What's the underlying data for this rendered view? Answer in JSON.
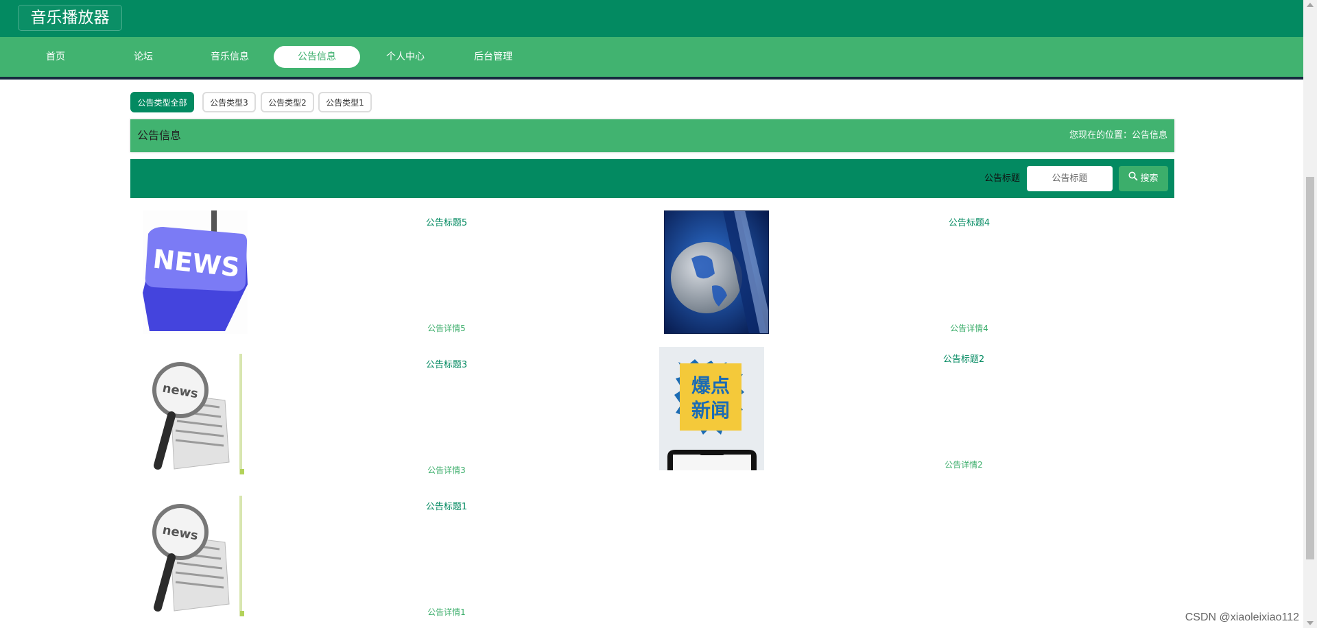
{
  "app": {
    "title": "音乐播放器"
  },
  "nav": {
    "items": [
      "首页",
      "论坛",
      "音乐信息",
      "公告信息",
      "个人中心",
      "后台管理"
    ],
    "active": "公告信息"
  },
  "filters": {
    "items": [
      "公告类型全部",
      "公告类型3",
      "公告类型2",
      "公告类型1"
    ],
    "active": "公告类型全部"
  },
  "section": {
    "title": "公告信息",
    "location_label": "您现在的位置：",
    "location_value": "公告信息"
  },
  "search": {
    "label": "公告标题",
    "placeholder": "公告标题",
    "button": "搜索"
  },
  "announcements": [
    {
      "title": "公告标题5",
      "detail": "公告详情5",
      "image": "news-key-image"
    },
    {
      "title": "公告标题4",
      "detail": "公告详情4",
      "image": "globe-broadcast-image"
    },
    {
      "title": "公告标题3",
      "detail": "公告详情3",
      "image": "magnifier-newspaper-image"
    },
    {
      "title": "公告标题2",
      "detail": "公告详情2",
      "image": "breaking-news-phone-image"
    },
    {
      "title": "公告标题1",
      "detail": "公告详情1",
      "image": "magnifier-newspaper-image"
    }
  ],
  "watermark": "CSDN @xiaoleixiao112",
  "colors": {
    "primary": "#038a61",
    "accent": "#41b370",
    "white": "#ffffff"
  }
}
